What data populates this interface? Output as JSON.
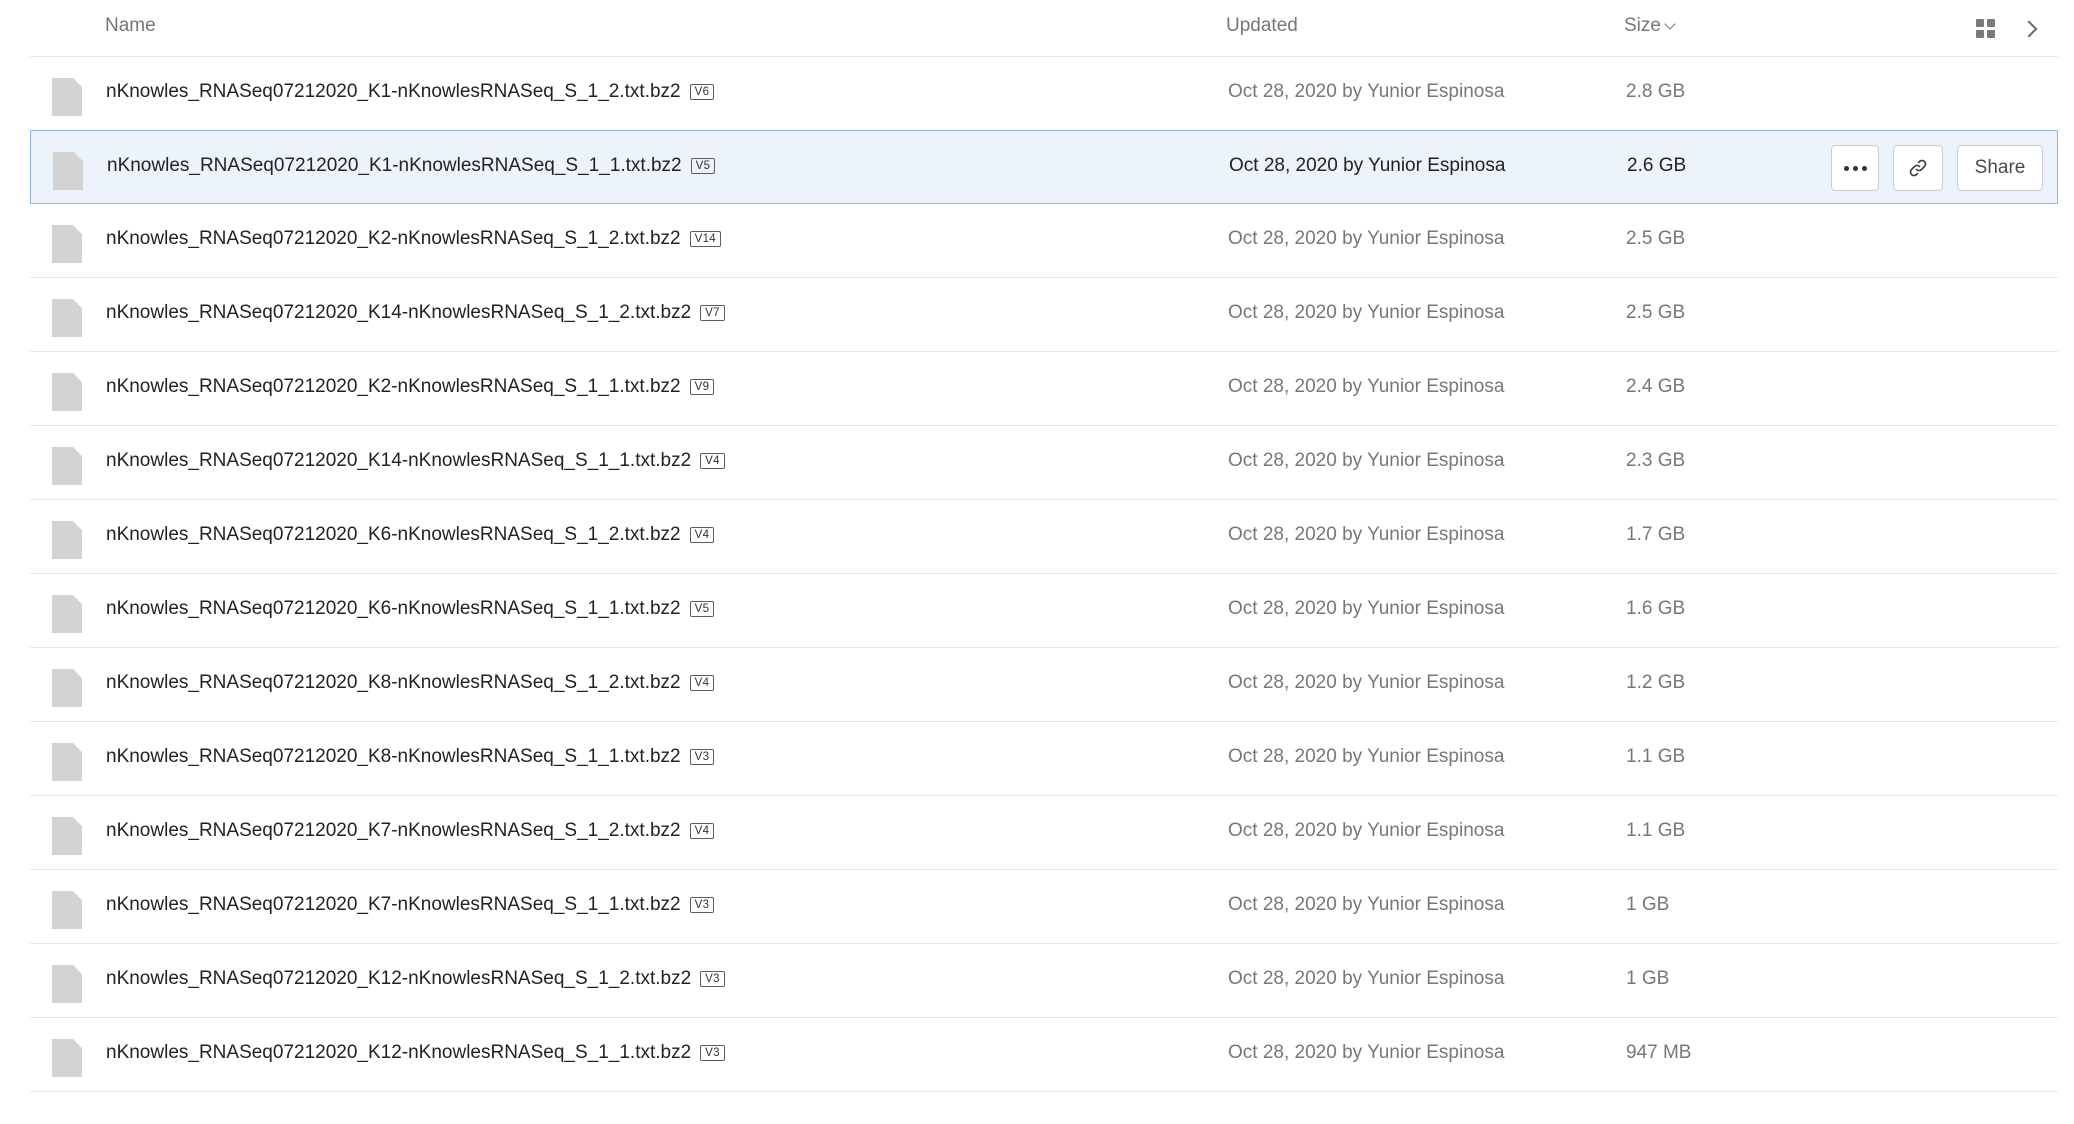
{
  "header": {
    "name": "Name",
    "updated": "Updated",
    "size": "Size"
  },
  "actions": {
    "share": "Share",
    "more_icon": "more-options-icon",
    "link_icon": "link-icon"
  },
  "colors": {
    "selected_bg": "#edf3fb",
    "selected_border": "#8fb5e6",
    "file_icon": "#d3d3d3"
  },
  "files": [
    {
      "name": "nKnowles_RNASeq07212020_K1-nKnowlesRNASeq_S_1_2.txt.bz2",
      "version": "V6",
      "updated": "Oct 28, 2020 by Yunior Espinosa",
      "size": "2.8 GB"
    },
    {
      "name": "nKnowles_RNASeq07212020_K1-nKnowlesRNASeq_S_1_1.txt.bz2",
      "version": "V5",
      "updated": "Oct 28, 2020 by Yunior Espinosa",
      "size": "2.6 GB",
      "selected": true
    },
    {
      "name": "nKnowles_RNASeq07212020_K2-nKnowlesRNASeq_S_1_2.txt.bz2",
      "version": "V14",
      "updated": "Oct 28, 2020 by Yunior Espinosa",
      "size": "2.5 GB"
    },
    {
      "name": "nKnowles_RNASeq07212020_K14-nKnowlesRNASeq_S_1_2.txt.bz2",
      "version": "V7",
      "updated": "Oct 28, 2020 by Yunior Espinosa",
      "size": "2.5 GB"
    },
    {
      "name": "nKnowles_RNASeq07212020_K2-nKnowlesRNASeq_S_1_1.txt.bz2",
      "version": "V9",
      "updated": "Oct 28, 2020 by Yunior Espinosa",
      "size": "2.4 GB"
    },
    {
      "name": "nKnowles_RNASeq07212020_K14-nKnowlesRNASeq_S_1_1.txt.bz2",
      "version": "V4",
      "updated": "Oct 28, 2020 by Yunior Espinosa",
      "size": "2.3 GB"
    },
    {
      "name": "nKnowles_RNASeq07212020_K6-nKnowlesRNASeq_S_1_2.txt.bz2",
      "version": "V4",
      "updated": "Oct 28, 2020 by Yunior Espinosa",
      "size": "1.7 GB"
    },
    {
      "name": "nKnowles_RNASeq07212020_K6-nKnowlesRNASeq_S_1_1.txt.bz2",
      "version": "V5",
      "updated": "Oct 28, 2020 by Yunior Espinosa",
      "size": "1.6 GB"
    },
    {
      "name": "nKnowles_RNASeq07212020_K8-nKnowlesRNASeq_S_1_2.txt.bz2",
      "version": "V4",
      "updated": "Oct 28, 2020 by Yunior Espinosa",
      "size": "1.2 GB"
    },
    {
      "name": "nKnowles_RNASeq07212020_K8-nKnowlesRNASeq_S_1_1.txt.bz2",
      "version": "V3",
      "updated": "Oct 28, 2020 by Yunior Espinosa",
      "size": "1.1 GB"
    },
    {
      "name": "nKnowles_RNASeq07212020_K7-nKnowlesRNASeq_S_1_2.txt.bz2",
      "version": "V4",
      "updated": "Oct 28, 2020 by Yunior Espinosa",
      "size": "1.1 GB"
    },
    {
      "name": "nKnowles_RNASeq07212020_K7-nKnowlesRNASeq_S_1_1.txt.bz2",
      "version": "V3",
      "updated": "Oct 28, 2020 by Yunior Espinosa",
      "size": "1 GB"
    },
    {
      "name": "nKnowles_RNASeq07212020_K12-nKnowlesRNASeq_S_1_2.txt.bz2",
      "version": "V3",
      "updated": "Oct 28, 2020 by Yunior Espinosa",
      "size": "1 GB"
    },
    {
      "name": "nKnowles_RNASeq07212020_K12-nKnowlesRNASeq_S_1_1.txt.bz2",
      "version": "V3",
      "updated": "Oct 28, 2020 by Yunior Espinosa",
      "size": "947 MB"
    }
  ]
}
